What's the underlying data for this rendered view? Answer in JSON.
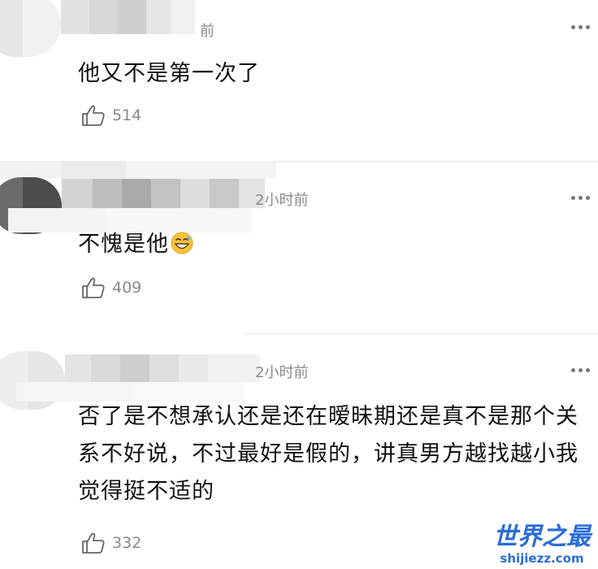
{
  "comments": [
    {
      "time": "前",
      "content": "他又不是第一次了",
      "likes": "514"
    },
    {
      "time": "2小时前",
      "content": "不愧是他",
      "emoji": "grinning-sweat-emoji",
      "likes": "409"
    },
    {
      "time": "2小时前",
      "content": "否了是不想承认还是还在暧昧期还是真不是那个关系不好说，不过最好是假的，讲真男方越找越小我觉得挺不适的",
      "likes": "332"
    }
  ],
  "watermark": {
    "title": "世界之最",
    "url": "shijiezz.com"
  },
  "colors": {
    "meta": "#8a8a8a",
    "divider": "#e8e8e8",
    "watermark": "#2b6cd8"
  }
}
